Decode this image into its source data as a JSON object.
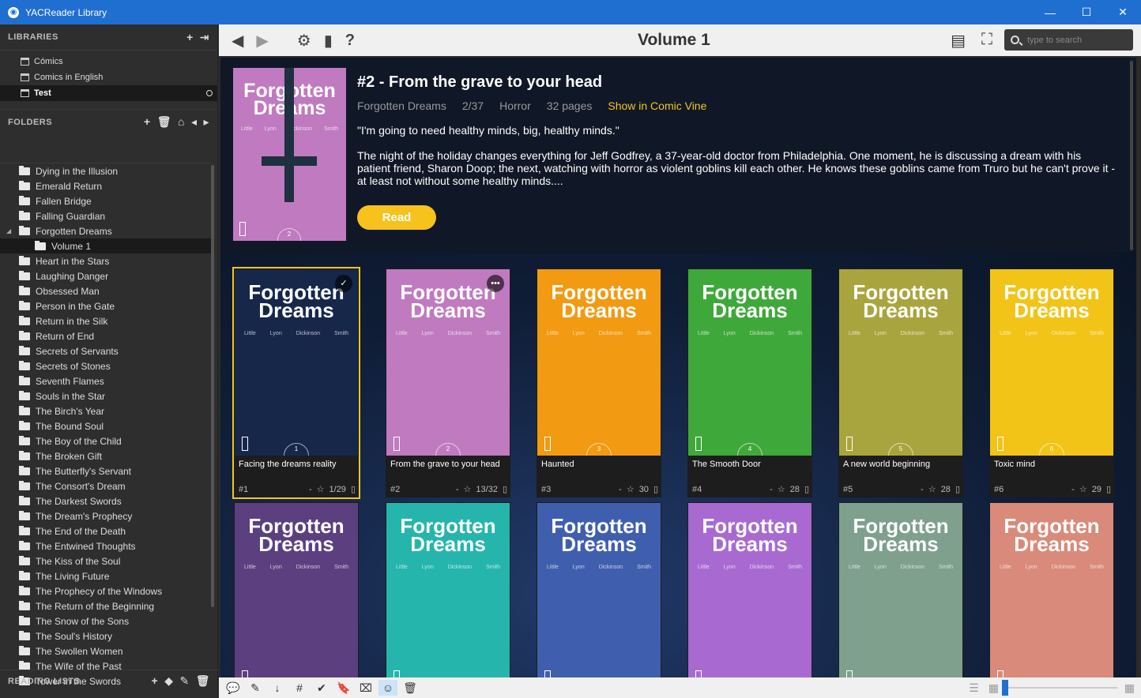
{
  "window": {
    "title": "YACReader Library"
  },
  "sidebar": {
    "libraries_header": "LIBRARIES",
    "libraries": [
      {
        "label": "Cómics",
        "active": false
      },
      {
        "label": "Comics in English",
        "active": false
      },
      {
        "label": "Test",
        "active": true
      }
    ],
    "folders_header": "FOLDERS",
    "folders": [
      {
        "label": "Dying in the Illusion"
      },
      {
        "label": "Emerald Return"
      },
      {
        "label": "Fallen Bridge"
      },
      {
        "label": "Falling Guardian"
      },
      {
        "label": "Forgotten Dreams",
        "expanded": true
      },
      {
        "label": "Volume 1",
        "child": true
      },
      {
        "label": "Heart in the Stars"
      },
      {
        "label": "Laughing Danger"
      },
      {
        "label": "Obsessed Man"
      },
      {
        "label": "Person in the Gate"
      },
      {
        "label": "Return in the Silk"
      },
      {
        "label": "Return of End"
      },
      {
        "label": "Secrets of Servants"
      },
      {
        "label": "Secrets of Stones"
      },
      {
        "label": "Seventh Flames"
      },
      {
        "label": "Souls in the Star"
      },
      {
        "label": "The Birch's Year"
      },
      {
        "label": "The Bound Soul"
      },
      {
        "label": "The Boy of the Child"
      },
      {
        "label": "The Broken Gift"
      },
      {
        "label": "The Butterfly's Servant"
      },
      {
        "label": "The Consort's Dream"
      },
      {
        "label": "The Darkest Swords"
      },
      {
        "label": "The Dream's Prophecy"
      },
      {
        "label": "The End of the Death"
      },
      {
        "label": "The Entwined Thoughts"
      },
      {
        "label": "The Kiss of the Soul"
      },
      {
        "label": "The Living Future"
      },
      {
        "label": "The Prophecy of the Windows"
      },
      {
        "label": "The Return of the Beginning"
      },
      {
        "label": "The Snow of the Sons"
      },
      {
        "label": "The Soul's History"
      },
      {
        "label": "The Swollen Women"
      },
      {
        "label": "The Wife of the Past"
      },
      {
        "label": "Tower in the Swords"
      }
    ],
    "reading_lists_header": "READING LISTS"
  },
  "toolbar": {
    "title": "Volume 1",
    "search_placeholder": "type to search"
  },
  "info": {
    "title": "#2 - From the grave to your head",
    "series": "Forgotten Dreams",
    "number": "2/37",
    "genre": "Horror",
    "pages": "32 pages",
    "comic_vine": "Show in Comic Vine",
    "quote": "\"I'm going to need healthy  minds, big, healthy minds.\"",
    "synopsis": "The night of the holiday changes everything for Jeff Godfrey, a 37-year-old doctor from Philadelphia. One moment, he is discussing a dream with his patient friend, Sharon Doop; the next, watching with horror as violent goblins kill each other. He knows these goblins came from Truro but he can't prove it - at least not without some healthy minds....",
    "read_label": "Read",
    "cover_number": "2"
  },
  "cover_title_line1": "Forgotten",
  "cover_title_line2": "Dreams",
  "cover_authors": [
    "Little",
    "Lyon",
    "Dickinson",
    "Smith"
  ],
  "comics": [
    {
      "title": "Facing the dreams reality",
      "number": "#1",
      "rating": "-",
      "pages": "1/29",
      "cover_num": "1",
      "color": "#16274a",
      "selected": true,
      "badge": "✓"
    },
    {
      "title": "From the grave to your head",
      "number": "#2",
      "rating": "-",
      "pages": "13/32",
      "cover_num": "2",
      "color": "#c07ac0",
      "badge": "•••"
    },
    {
      "title": "Haunted",
      "number": "#3",
      "rating": "-",
      "pages": "30",
      "cover_num": "3",
      "color": "#f29a12"
    },
    {
      "title": "The Smooth Door",
      "number": "#4",
      "rating": "-",
      "pages": "28",
      "cover_num": "4",
      "color": "#3fa83a"
    },
    {
      "title": "A new world beginning",
      "number": "#5",
      "rating": "-",
      "pages": "28",
      "cover_num": "5",
      "color": "#a9a53e"
    },
    {
      "title": "Toxic mind",
      "number": "#6",
      "rating": "-",
      "pages": "29",
      "cover_num": "6",
      "color": "#f2c418"
    },
    {
      "title": "",
      "number": "",
      "rating": "",
      "pages": "",
      "cover_num": "",
      "color": "#5c3f7f"
    },
    {
      "title": "",
      "number": "",
      "rating": "",
      "pages": "",
      "cover_num": "",
      "color": "#25b5ad"
    },
    {
      "title": "",
      "number": "",
      "rating": "",
      "pages": "",
      "cover_num": "",
      "color": "#3f5fae"
    },
    {
      "title": "",
      "number": "",
      "rating": "",
      "pages": "",
      "cover_num": "",
      "color": "#a86ad1"
    },
    {
      "title": "",
      "number": "",
      "rating": "",
      "pages": "",
      "cover_num": "",
      "color": "#7ea08c"
    },
    {
      "title": "",
      "number": "",
      "rating": "",
      "pages": "",
      "cover_num": "",
      "color": "#d98a7a"
    }
  ]
}
